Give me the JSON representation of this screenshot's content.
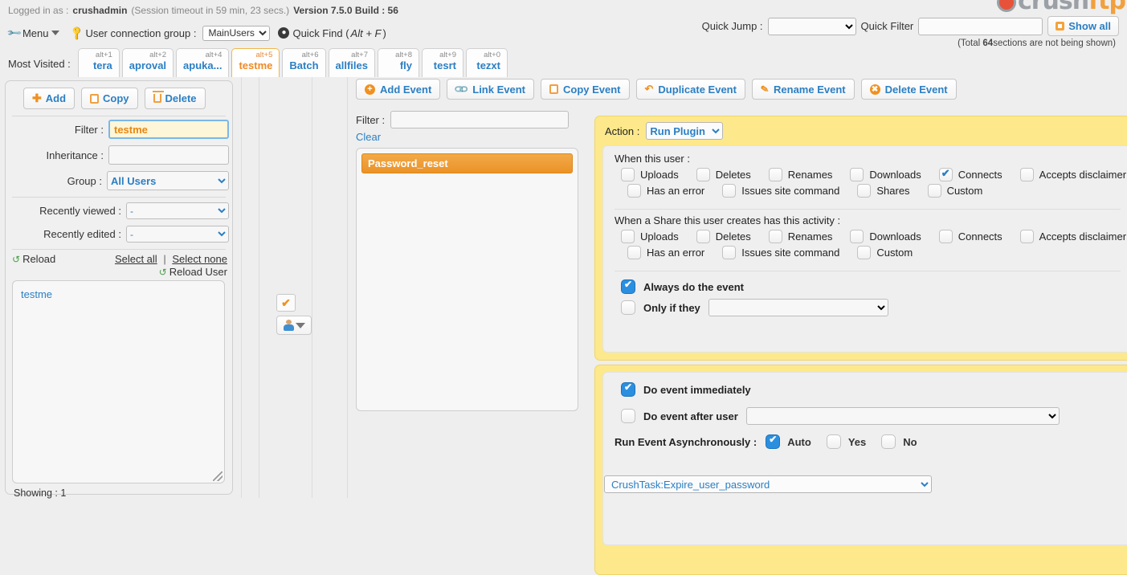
{
  "topbar": {
    "logged_in_label": "Logged in as :",
    "username": "crushadmin",
    "session": "(Session timeout in 59 min, 23 secs.)",
    "version": "Version 7.5.0 Build : 56",
    "logo_text_gray": "crush",
    "logo_text_orange": "ftp"
  },
  "menurow": {
    "menu_label": "Menu",
    "connection_group_label": "User connection group :",
    "connection_group_value": "MainUsers",
    "quick_find_label": "Quick Find (",
    "quick_find_shortcut": "Alt + F",
    "quick_find_close": ")"
  },
  "quickzone": {
    "quick_jump_label": "Quick Jump :",
    "quick_jump_value": "",
    "quick_filter_label": "Quick Filter",
    "quick_filter_value": "",
    "show_all_label": "Show all",
    "total_note_pre": "(Total ",
    "total_note_count": "64",
    "total_note_post": "sections are not being shown)"
  },
  "most_visited": {
    "label": "Most Visited :",
    "tabs": [
      {
        "alt": "alt+1",
        "name": "tera",
        "active": false
      },
      {
        "alt": "alt+2",
        "name": "aproval",
        "active": false
      },
      {
        "alt": "alt+4",
        "name": "apuka...",
        "active": false
      },
      {
        "alt": "alt+5",
        "name": "testme",
        "active": true
      },
      {
        "alt": "alt+6",
        "name": "Batch",
        "active": false
      },
      {
        "alt": "alt+7",
        "name": "allfiles",
        "active": false
      },
      {
        "alt": "alt+8",
        "name": "fly",
        "active": false
      },
      {
        "alt": "alt+9",
        "name": "tesrt",
        "active": false
      },
      {
        "alt": "alt+0",
        "name": "tezxt",
        "active": false
      }
    ]
  },
  "left_panel": {
    "add_label": "Add",
    "copy_label": "Copy",
    "delete_label": "Delete",
    "filter_label": "Filter :",
    "filter_value": "testme",
    "inheritance_label": "Inheritance :",
    "inheritance_value": "",
    "group_label": "Group :",
    "group_value": "All Users",
    "recently_viewed_label": "Recently viewed :",
    "recently_viewed_value": "-",
    "recently_edited_label": "Recently edited :",
    "recently_edited_value": "-",
    "reload_label": "Reload",
    "select_all_label": "Select all",
    "select_divider": "|",
    "select_none_label": "Select none",
    "reload_user_label": "Reload User",
    "users": [
      "testme"
    ],
    "showing_label": "Showing : 1"
  },
  "event_toolbar": [
    {
      "label": "Add Event",
      "icon": "circle-plus-icon"
    },
    {
      "label": "Link Event",
      "icon": "link-icon"
    },
    {
      "label": "Copy Event",
      "icon": "copy-icon"
    },
    {
      "label": "Duplicate Event",
      "icon": "duplicate-arrow-icon"
    },
    {
      "label": "Rename Event",
      "icon": "pencil-icon"
    },
    {
      "label": "Delete Event",
      "icon": "circle-x-icon"
    }
  ],
  "event_panel": {
    "filter_label": "Filter :",
    "filter_value": "",
    "clear_label": "Clear",
    "selected_event": "Password_reset"
  },
  "action_panel": {
    "action_label": "Action :",
    "action_value": "Run Plugin",
    "when_user_title": "When this user :",
    "user_checkboxes_row1": [
      {
        "label": "Uploads",
        "checked": false
      },
      {
        "label": "Deletes",
        "checked": false
      },
      {
        "label": "Renames",
        "checked": false
      },
      {
        "label": "Downloads",
        "checked": false
      },
      {
        "label": "Connects",
        "checked": true
      },
      {
        "label": "Accepts disclaimer",
        "checked": false
      }
    ],
    "user_checkboxes_row2": [
      {
        "label": "Has an error",
        "checked": false
      },
      {
        "label": "Issues site command",
        "checked": false
      },
      {
        "label": "Shares",
        "checked": false
      },
      {
        "label": "Custom",
        "checked": false
      }
    ],
    "share_title": "When a Share this user creates has this activity :",
    "share_checkboxes_row1": [
      {
        "label": "Uploads",
        "checked": false
      },
      {
        "label": "Deletes",
        "checked": false
      },
      {
        "label": "Renames",
        "checked": false
      },
      {
        "label": "Downloads",
        "checked": false
      },
      {
        "label": "Connects",
        "checked": false
      },
      {
        "label": "Accepts disclaimer",
        "checked": false
      }
    ],
    "share_checkboxes_row2": [
      {
        "label": "Has an error",
        "checked": false
      },
      {
        "label": "Issues site command",
        "checked": false
      },
      {
        "label": "Custom",
        "checked": false
      }
    ],
    "always_label": "Always do the event",
    "always_checked": true,
    "only_if_label": "Only if they",
    "only_if_checked": false,
    "only_if_value": ""
  },
  "timing_panel": {
    "immediate_label": "Do event immediately",
    "immediate_checked": true,
    "after_user_label": "Do event after user",
    "after_user_checked": false,
    "after_user_value": "",
    "async_label": "Run Event Asynchronously :",
    "async_options": [
      {
        "label": "Auto",
        "checked": true
      },
      {
        "label": "Yes",
        "checked": false
      },
      {
        "label": "No",
        "checked": false
      }
    ]
  },
  "task_select": {
    "value": "CrushTask:Expire_user_password"
  }
}
